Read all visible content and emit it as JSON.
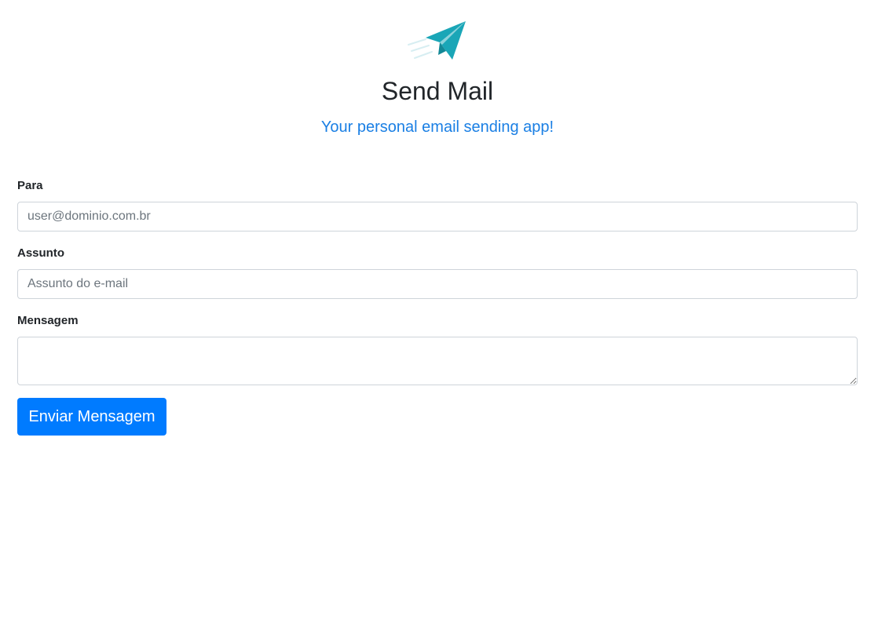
{
  "header": {
    "logo_icon": "paper-plane-icon",
    "title": "Send Mail",
    "subtitle": "Your personal email sending app!"
  },
  "form": {
    "to": {
      "label": "Para",
      "placeholder": "user@dominio.com.br",
      "value": ""
    },
    "subject": {
      "label": "Assunto",
      "placeholder": "Assunto do e-mail",
      "value": ""
    },
    "message": {
      "label": "Mensagem",
      "placeholder": "",
      "value": ""
    },
    "submit_label": "Enviar Mensagem"
  },
  "colors": {
    "accent": "#007bff",
    "subtitle": "#1a7fe4",
    "logo": "#17a2b8"
  }
}
